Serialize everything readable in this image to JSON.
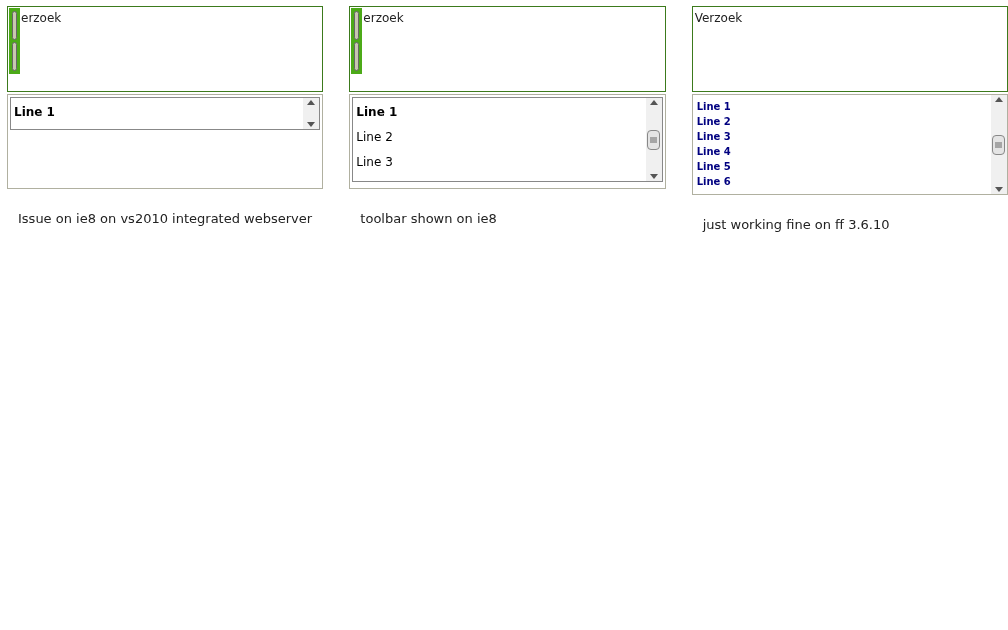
{
  "panels": [
    {
      "kind": "collapsed",
      "toolbar": true,
      "editor_text": "erzoek",
      "lines": [
        {
          "label": "Line 1",
          "selected": true
        }
      ],
      "caption": "Issue on ie8 on vs2010 integrated webserver"
    },
    {
      "kind": "inset",
      "toolbar": true,
      "editor_text": "erzoek",
      "lines": [
        {
          "label": "Line 1",
          "selected": true
        },
        {
          "label": "Line 2",
          "selected": false
        },
        {
          "label": "Line 3",
          "selected": false
        }
      ],
      "caption": "toolbar shown on ie8"
    },
    {
      "kind": "plain",
      "toolbar": false,
      "editor_text": "Verzoek",
      "lines": [
        {
          "label": "Line 1",
          "selected": false
        },
        {
          "label": "Line 2",
          "selected": false
        },
        {
          "label": "Line 3",
          "selected": false
        },
        {
          "label": "Line 4",
          "selected": false
        },
        {
          "label": "Line 5",
          "selected": false
        },
        {
          "label": "Line 6",
          "selected": false
        }
      ],
      "caption": "just working fine on ff 3.6.10"
    }
  ]
}
